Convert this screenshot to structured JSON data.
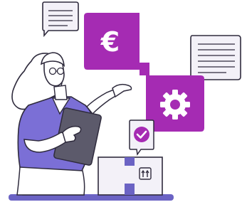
{
  "illustration": {
    "currency_symbol": "€",
    "colors": {
      "magenta": "#a52bb3",
      "magenta_dark": "#8f1f9c",
      "purple": "#7b6fd6",
      "purple_dark": "#5b50b8",
      "tablet": "#5c5a6b",
      "outline": "#2f2b3d",
      "skin": "#ffffff",
      "paper": "#f3f1f8",
      "ground": "#6b63c4"
    },
    "icons": [
      "speech-bubble-icon",
      "euro-icon",
      "gear-icon",
      "checkmark-icon",
      "fragile-icon"
    ]
  }
}
